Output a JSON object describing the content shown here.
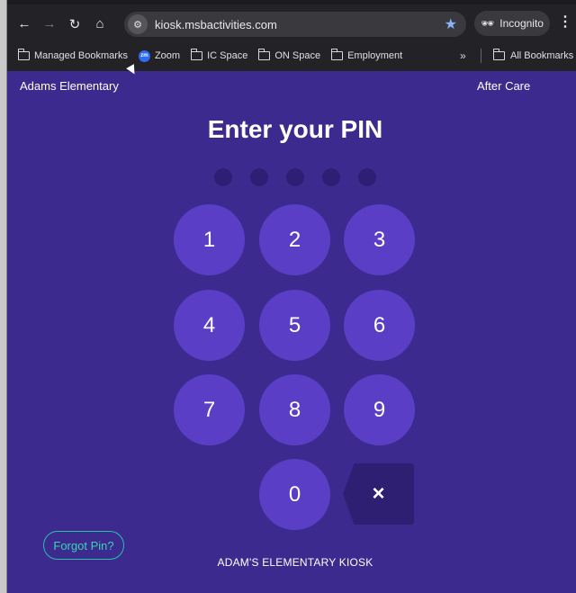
{
  "browser": {
    "url": "kiosk.msbactivities.com",
    "incognito_label": "Incognito",
    "bookmarks": [
      {
        "label": "Managed Bookmarks",
        "icon": "folder-icon"
      },
      {
        "label": "Zoom",
        "icon": "zoom-icon"
      },
      {
        "label": "IC Space",
        "icon": "folder-icon"
      },
      {
        "label": "ON Space",
        "icon": "folder-icon"
      },
      {
        "label": "Employment",
        "icon": "folder-icon"
      }
    ],
    "overflow_label": "»",
    "all_bookmarks_label": "All Bookmarks",
    "zoom_badge": "zm"
  },
  "kiosk": {
    "school_name": "Adams Elementary",
    "program_name": "After Care",
    "title": "Enter your PIN",
    "pin_length": 5,
    "keys": [
      "1",
      "2",
      "3",
      "4",
      "5",
      "6",
      "7",
      "8",
      "9",
      "0"
    ],
    "backspace_label": "×",
    "forgot_label": "Forgot Pin?",
    "footer": "ADAM'S ELEMENTARY KIOSK"
  },
  "colors": {
    "background": "#3c2a8e",
    "key": "#5a3fc6",
    "dot_empty": "#2e1f74",
    "accent": "#38d4b4"
  }
}
